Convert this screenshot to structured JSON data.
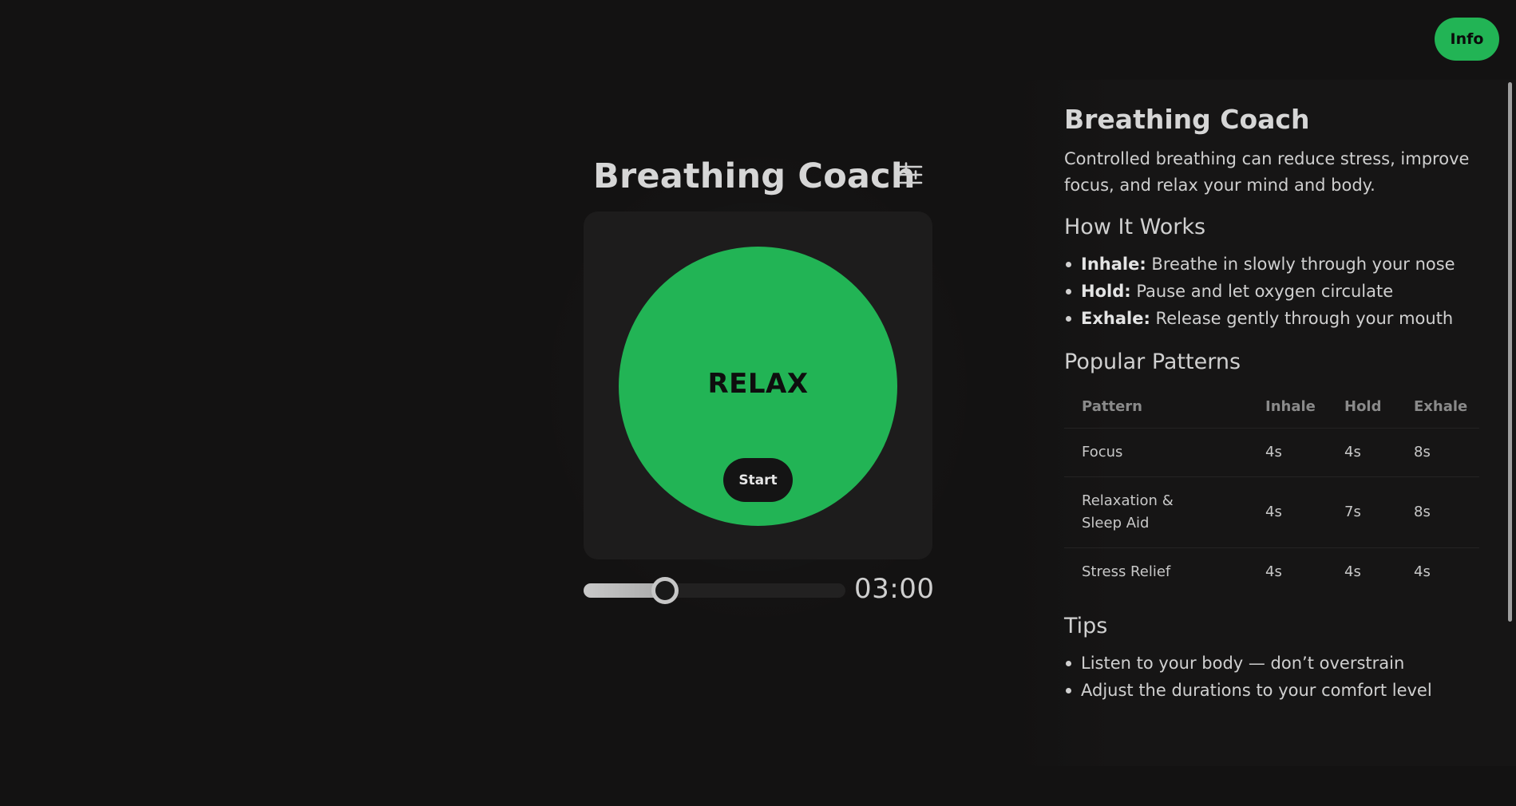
{
  "header": {
    "info_label": "Info"
  },
  "coach": {
    "title": "Breathing Coach",
    "phase": "RELAX",
    "start_label": "Start",
    "timer": "03:00",
    "duration_progress": 0.31,
    "accent_color": "#22b455",
    "settings_icon": "sliders-icon"
  },
  "info": {
    "title": "Breathing Coach",
    "intro": "Controlled breathing can reduce stress, improve focus, and relax your mind and body.",
    "how_heading": "How It Works",
    "how_items": [
      {
        "term": "Inhale:",
        "desc": "Breathe in slowly through your nose"
      },
      {
        "term": "Hold:",
        "desc": "Pause and let oxygen circulate"
      },
      {
        "term": "Exhale:",
        "desc": "Release gently through your mouth"
      }
    ],
    "patterns_heading": "Popular Patterns",
    "table": {
      "headers": [
        "Pattern",
        "Inhale",
        "Hold",
        "Exhale"
      ],
      "rows": [
        [
          "Focus",
          "4s",
          "4s",
          "8s"
        ],
        [
          "Relaxation & Sleep Aid",
          "4s",
          "7s",
          "8s"
        ],
        [
          "Stress Relief",
          "4s",
          "4s",
          "4s"
        ]
      ]
    },
    "tips_heading": "Tips",
    "tips": [
      "Listen to your body — don’t overstrain",
      "Adjust the durations to your comfort level"
    ]
  }
}
